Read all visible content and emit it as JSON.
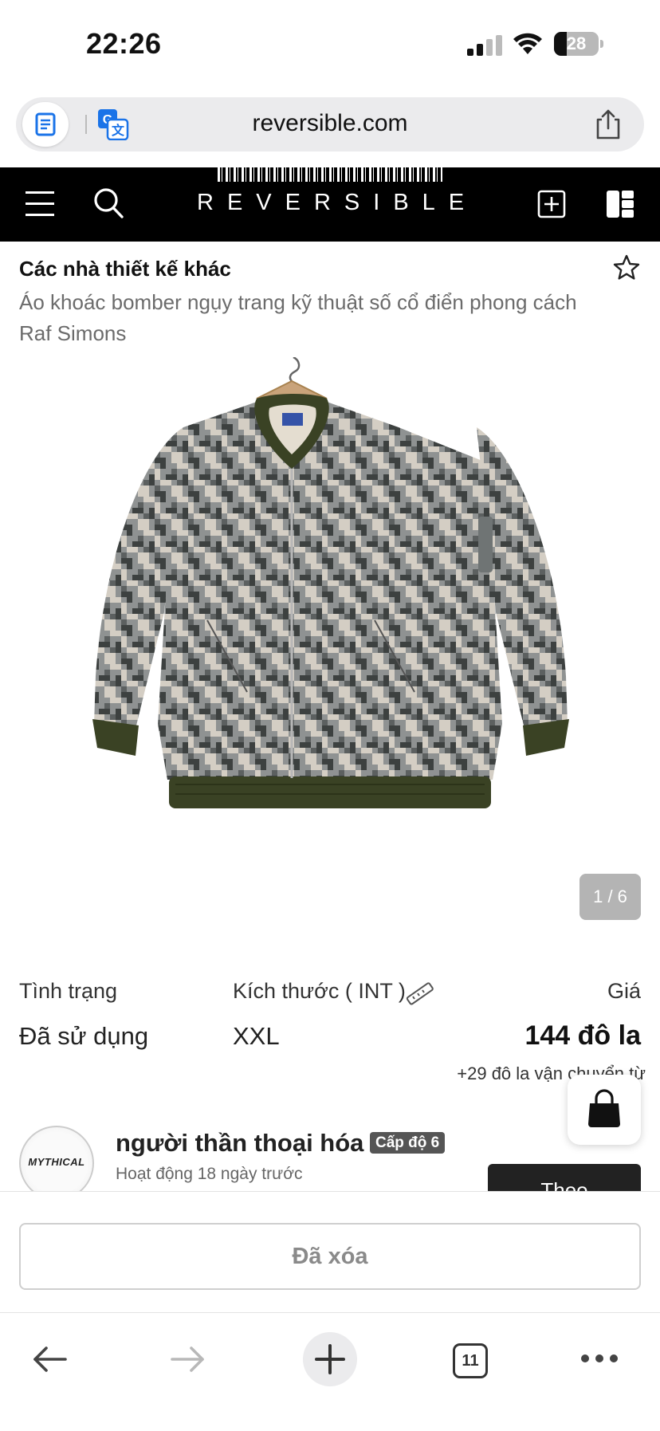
{
  "status_bar": {
    "time": "22:26",
    "battery": "28",
    "battery_level": 0.28,
    "icons": [
      "signal-icon",
      "wifi-icon",
      "battery-icon"
    ]
  },
  "browser": {
    "url": "reversible.com",
    "tab_count": "11",
    "icons": [
      "reader-icon",
      "translate-icon",
      "share-icon",
      "back-arrow-icon",
      "forward-arrow-icon",
      "plus-icon",
      "tabs-icon",
      "more-icon"
    ]
  },
  "site_header": {
    "logo": "REVERSIBLE",
    "icons": [
      "hamburger-icon",
      "search-icon",
      "add-listing-icon",
      "layout-icon"
    ]
  },
  "product": {
    "designer": "Các nhà thiết kế khác",
    "title": "Áo khoác bomber ngụy trang kỹ thuật số cổ điển phong cách Raf Simons",
    "image_counter": "1 / 6",
    "image_subject": "digital camo bomber jacket",
    "attributes": {
      "condition_label": "Tình trạng",
      "condition_value": "Đã sử dụng",
      "size_label": "Kích thước ( INT )",
      "size_value": "XXL",
      "price_label": "Giá",
      "price_value": "144 đô la",
      "shipping": "+29 đô la vận chuyển từ"
    }
  },
  "seller": {
    "avatar_text": "MYTHICAL",
    "name": "người thần thoại hóa",
    "level": "Cấp độ 6",
    "activity": "Hoạt động 18 ngày trước",
    "follow_label": "Theo"
  },
  "actions": {
    "removed_label": "Đã xóa"
  },
  "colors": {
    "header_bg": "#000000",
    "badge_bg": "#b4b4b4",
    "level_badge_bg": "#555555",
    "camo_base": "#8f9292",
    "camo_dark": "#3d4140",
    "camo_light": "#d4cec4",
    "jacket_rib": "#3a4224"
  }
}
